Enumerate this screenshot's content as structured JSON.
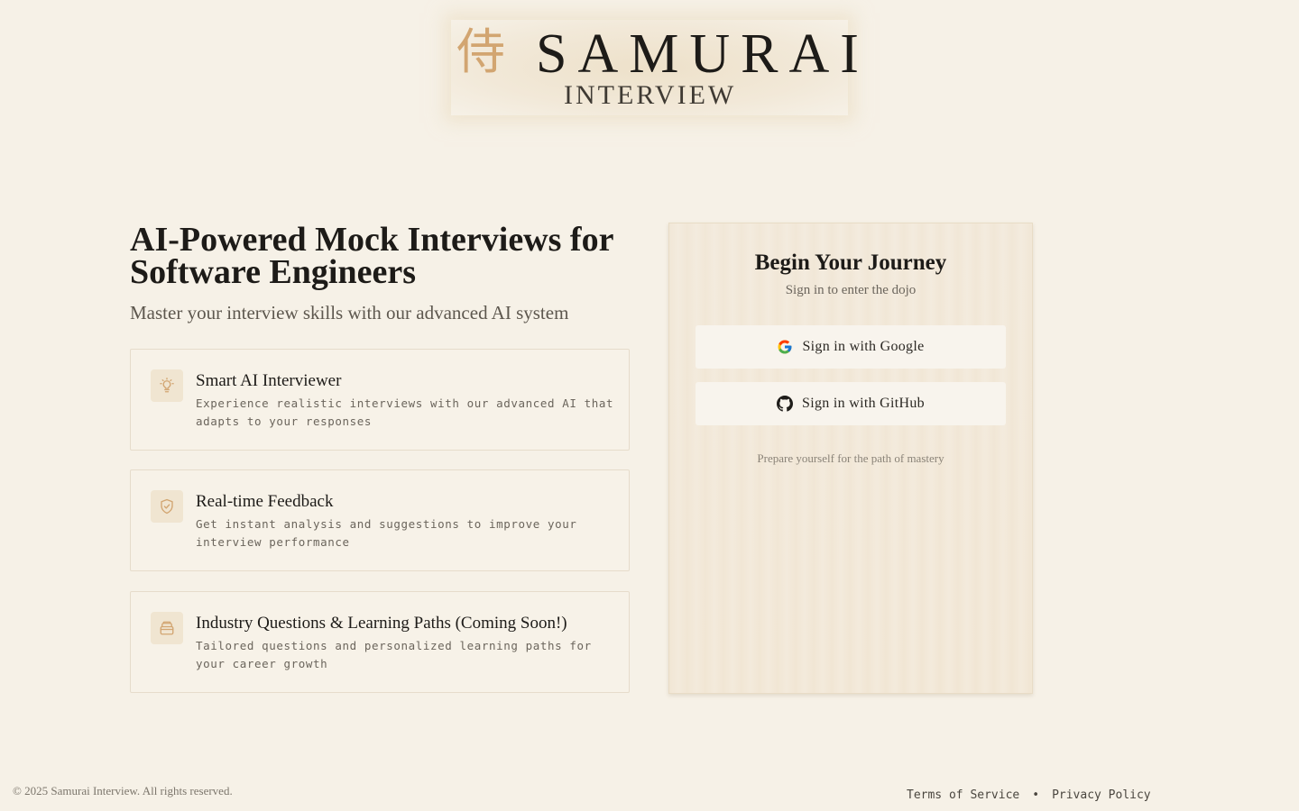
{
  "logo": {
    "kanji": "侍",
    "title": "SAMURAI",
    "subtitle": "INTERVIEW"
  },
  "hero": {
    "title": "AI-Powered Mock Interviews for Software Engineers",
    "subtitle": "Master your interview skills with our advanced AI system"
  },
  "features": [
    {
      "icon": "lightbulb-icon",
      "title": "Smart AI Interviewer",
      "description": "Experience realistic interviews with our advanced AI that adapts to your responses"
    },
    {
      "icon": "shield-check-icon",
      "title": "Real-time Feedback",
      "description": "Get instant analysis and suggestions to improve your interview performance"
    },
    {
      "icon": "archive-box-icon",
      "title": "Industry Questions & Learning Paths (Coming Soon!)",
      "description": "Tailored questions and personalized learning paths for your career growth"
    }
  ],
  "signin": {
    "title": "Begin Your Journey",
    "subtitle": "Sign in to enter the dojo",
    "google_label": "Sign in with Google",
    "github_label": "Sign in with GitHub",
    "note": "Prepare yourself for the path of mastery"
  },
  "footer": {
    "copyright": "© 2025 Samurai Interview. All rights reserved.",
    "terms": "Terms of Service",
    "separator": "•",
    "privacy": "Privacy Policy"
  },
  "colors": {
    "background": "#f6f1e7",
    "accent": "#d2a571",
    "text": "#1d1b18"
  }
}
